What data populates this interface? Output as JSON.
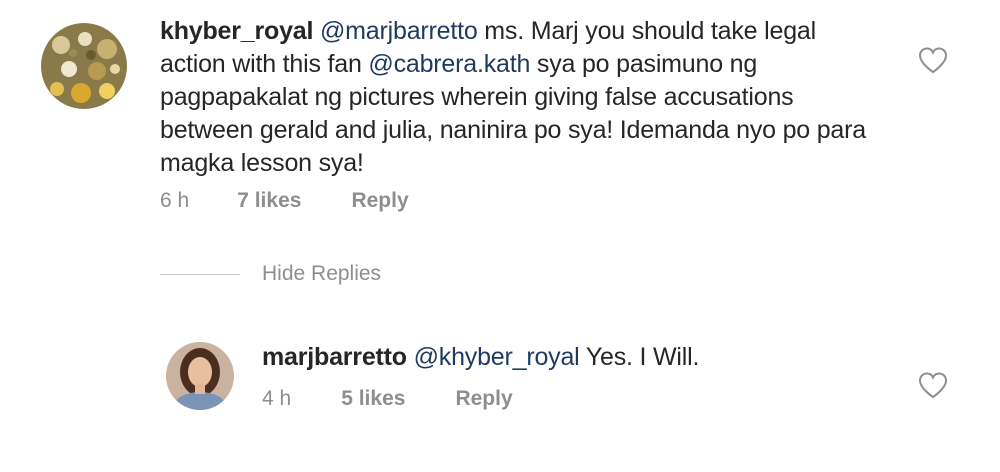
{
  "comments": [
    {
      "username": "khyber_royal",
      "mention1": "@marjbarretto",
      "text1": " ms. Marj you should take legal action with this fan ",
      "mention2": "@cabrera.kath",
      "text2": " sya po pasimuno ng pagpapakalat ng pictures wherein giving false accusations between gerald and julia, naninira po sya! Idemanda nyo po para magka lesson sya!",
      "time": "6 h",
      "likes": "7 likes",
      "reply": "Reply"
    }
  ],
  "replies_toggle": "Hide Replies",
  "reply_comment": {
    "username": "marjbarretto",
    "mention": "@khyber_royal",
    "text": " Yes. I Will.",
    "time": "4 h",
    "likes": "5 likes",
    "reply": "Reply"
  },
  "icons": {
    "like": "heart-outline-icon"
  },
  "colors": {
    "mention": "#1e3a5f",
    "meta": "#8e8e8e",
    "text": "#262626"
  }
}
